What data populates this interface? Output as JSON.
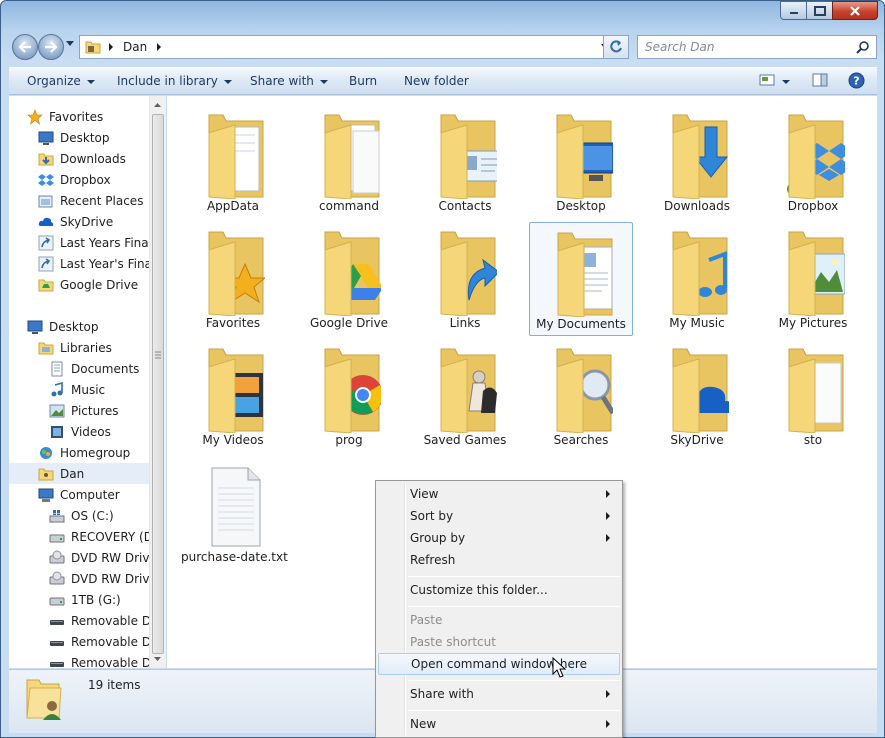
{
  "window": {
    "caption_buttons": [
      "minimize",
      "maximize",
      "close"
    ]
  },
  "address": {
    "path": [
      "Dan"
    ],
    "search_placeholder": "Search Dan"
  },
  "toolbar": {
    "organize": "Organize",
    "include_in_library": "Include in library",
    "share_with": "Share with",
    "burn": "Burn",
    "new_folder": "New folder"
  },
  "sidebar": {
    "favorites": {
      "header": "Favorites",
      "items": [
        "Desktop",
        "Downloads",
        "Dropbox",
        "Recent Places",
        "SkyDrive",
        "Last Years Financ",
        "Last Year's Financ",
        "Google Drive"
      ]
    },
    "desktop": {
      "header": "Desktop",
      "libraries": "Libraries",
      "library_items": [
        "Documents",
        "Music",
        "Pictures",
        "Videos"
      ],
      "homegroup": "Homegroup",
      "user": "Dan",
      "computer": "Computer",
      "drives": [
        "OS (C:)",
        "RECOVERY (D:)",
        "DVD RW Drive (",
        "DVD RW Drive (",
        "1TB (G:)",
        "Removable Dis",
        "Removable Dis",
        "Removable Dis"
      ]
    }
  },
  "items": [
    {
      "name": "AppData",
      "icon": "folder-docs-icon"
    },
    {
      "name": "command",
      "icon": "folder-pages-icon"
    },
    {
      "name": "Contacts",
      "icon": "folder-contacts-icon"
    },
    {
      "name": "Desktop",
      "icon": "folder-desktop-icon"
    },
    {
      "name": "Downloads",
      "icon": "folder-download-icon"
    },
    {
      "name": "Dropbox",
      "icon": "folder-dropbox-icon"
    },
    {
      "name": "Favorites",
      "icon": "folder-star-icon"
    },
    {
      "name": "Google Drive",
      "icon": "folder-gdrive-icon"
    },
    {
      "name": "Links",
      "icon": "folder-links-icon"
    },
    {
      "name": "My Documents",
      "icon": "folder-documents-icon"
    },
    {
      "name": "My Music",
      "icon": "folder-music-icon"
    },
    {
      "name": "My Pictures",
      "icon": "folder-pictures-icon"
    },
    {
      "name": "My Videos",
      "icon": "folder-videos-icon"
    },
    {
      "name": "prog",
      "icon": "folder-chrome-icon"
    },
    {
      "name": "Saved Games",
      "icon": "folder-games-icon"
    },
    {
      "name": "Searches",
      "icon": "folder-search-icon"
    },
    {
      "name": "SkyDrive",
      "icon": "folder-skydrive-icon"
    },
    {
      "name": "sto",
      "icon": "folder-file-icon"
    },
    {
      "name": "purchase-date.txt",
      "icon": "text-file-icon"
    }
  ],
  "status": {
    "count": "19 items"
  },
  "context_menu": {
    "view": "View",
    "sort_by": "Sort by",
    "group_by": "Group by",
    "refresh": "Refresh",
    "customize": "Customize this folder...",
    "paste": "Paste",
    "paste_shortcut": "Paste shortcut",
    "open_command": "Open command window here",
    "share_with": "Share with",
    "new": "New"
  },
  "colors": {
    "folder": "#f5d77a",
    "selection": "#84acdd",
    "accent": "#1e395b"
  }
}
